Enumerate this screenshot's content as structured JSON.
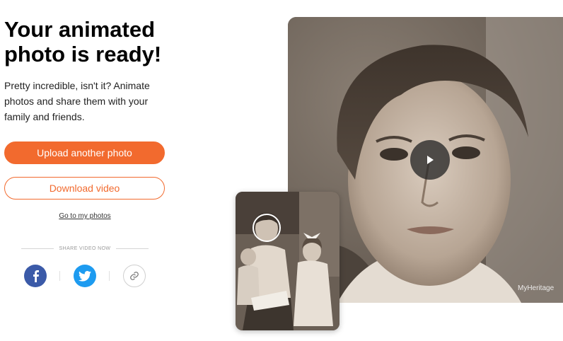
{
  "hero": {
    "title": "Your animated\nphoto is ready!",
    "description": "Pretty incredible, isn't it? Animate photos and share them with your family and friends."
  },
  "actions": {
    "upload_label": "Upload another photo",
    "download_label": "Download video",
    "my_photos_link": "Go to my photos"
  },
  "share": {
    "label": "SHARE VIDEO NOW",
    "buttons": [
      {
        "icon": "facebook-icon",
        "color": "#3b5aa8"
      },
      {
        "icon": "twitter-icon",
        "color": "#1d9bf0"
      },
      {
        "icon": "link-icon",
        "color": "#ffffff"
      }
    ]
  },
  "preview": {
    "watermark": "MyHeritage",
    "play_icon": "play-icon"
  },
  "colors": {
    "accent": "#f26a2e"
  }
}
